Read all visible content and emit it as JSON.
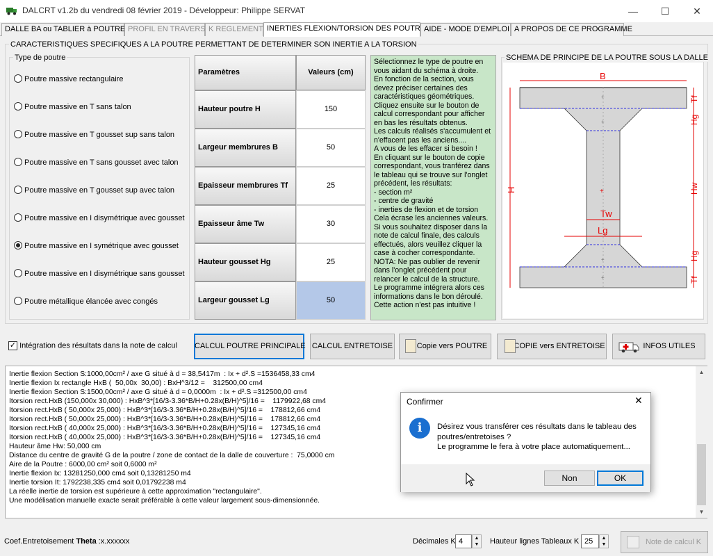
{
  "window": {
    "title": "DALCRT v1.2b du vendredi 08 février 2019 - Développeur: Philippe SERVAT",
    "minimize": "—",
    "maximize": "☐",
    "close": "✕"
  },
  "tabs": [
    {
      "label": "DALLE BA ou TABLIER à POUTRES"
    },
    {
      "label": "PROFIL EN TRAVERS"
    },
    {
      "label": "K REGLEMENT"
    },
    {
      "label": "INERTIES FLEXION/TORSION DES POUTRES"
    },
    {
      "label": "AIDE - MODE D'EMPLOI"
    },
    {
      "label": "A PROPOS DE CE PROGRAMME"
    }
  ],
  "main_group": {
    "title": "CARACTERISTIQUES SPECIFIQUES A LA POUTRE PERMETTANT DE DETERMINER SON INERTIE A LA TORSION"
  },
  "poutre_type": {
    "title": "Type de poutre",
    "options": [
      {
        "label": "Poutre massive rectangulaire",
        "selected": false
      },
      {
        "label": "Poutre massive en T sans talon",
        "selected": false
      },
      {
        "label": "Poutre massive en T gousset sup sans talon",
        "selected": false
      },
      {
        "label": "Poutre massive en T sans gousset avec talon",
        "selected": false
      },
      {
        "label": "Poutre massive en T gousset sup avec talon",
        "selected": false
      },
      {
        "label": "Poutre massive en I disymétrique avec gousset",
        "selected": false
      },
      {
        "label": "Poutre massive en I symétrique avec gousset",
        "selected": true
      },
      {
        "label": "Poutre massive en I disymétrique sans gousset",
        "selected": false
      },
      {
        "label": "Poutre métallique élancée avec congés",
        "selected": false
      }
    ]
  },
  "params_table": {
    "header_param": "Paramètres",
    "header_value": "Valeurs (cm)",
    "rows": [
      {
        "param": "Hauteur poutre H",
        "value": "150"
      },
      {
        "param": "Largeur membrures B",
        "value": "50"
      },
      {
        "param": "Epaisseur membrures Tf",
        "value": "25"
      },
      {
        "param": "Epaisseur âme Tw",
        "value": "30"
      },
      {
        "param": "Hauteur gousset Hg",
        "value": "25"
      },
      {
        "param": "Largeur gousset Lg",
        "value": "50"
      }
    ]
  },
  "info_text": "Sélectionnez le type de poutre en vous aidant du schéma à droite.\nEn fonction de la section, vous devez préciser certaines des caractéristiques géométriques.\nCliquez ensuite sur le bouton de calcul correspondant pour afficher en bas les résultats obtenus.\nLes calculs réalisés s'accumulent et n'effacent pas les anciens....\nA vous de les effacer si besoin !\nEn cliquant sur le bouton de copie correspondant, vous tranférez dans le tableau qui se trouve sur l'onglet précédent, les résultats:\n- section m²\n- centre de gravité\n- inerties de flexion et de torsion\nCela écrase les anciennes valeurs.\nSi vous souhaitez disposer dans la note de calcul finale, des calculs effectués, alors veuillez cliquer la case à cocher correspondante.\nNOTA: Ne pas oublier de revenir dans l'onglet précédent pour relancer le calcul de la structure.\nLe programme intégrera alors ces informations dans le bon déroulé.\nCette action n'est pas intuitive !",
  "schema": {
    "title": "SCHEMA DE PRINCIPE DE LA POUTRE SOUS LA DALLE",
    "labels": {
      "B": "B",
      "Tf": "Tf",
      "Hg": "Hg",
      "H": "H",
      "Hw": "Hw",
      "Tw": "Tw",
      "Lg": "Lg"
    }
  },
  "checkbox": {
    "label": "Intégration des résultats dans la note de calcul",
    "checked": true
  },
  "buttons": {
    "calcul_poutre": "CALCUL POUTRE PRINCIPALE",
    "calcul_entretoise": "CALCUL ENTRETOISE",
    "copie_poutre": "Copie vers POUTRE",
    "copie_entretoise": "COPIE vers ENTRETOISE",
    "infos_utiles": "INFOS UTILES"
  },
  "results": [
    "Inertie flexion Section S:1000,00cm² / axe G situé à d = 38,5417m  : Ix + d².S =1536458,33 cm4",
    "Inertie flexion Ix rectangle HxB (  50,00x  30,00) : BxH^3/12 =    312500,00 cm4",
    "Inertie flexion Section S:1500,00cm² / axe G situé à d = 0,0000m  : Ix + d².S =312500,00 cm4",
    "Itorsion rect.HxB (150,000x 30,000) : HxB^3*[16/3-3.36*B/H+0.28x(B/H)^5]/16 =    1179922,68 cm4",
    "Itorsion rect.HxB ( 50,000x 25,000) : HxB^3*[16/3-3.36*B/H+0.28x(B/H)^5]/16 =    178812,66 cm4",
    "Itorsion rect.HxB ( 50,000x 25,000) : HxB^3*[16/3-3.36*B/H+0.28x(B/H)^5]/16 =    178812,66 cm4",
    "Itorsion rect.HxB ( 40,000x 25,000) : HxB^3*[16/3-3.36*B/H+0.28x(B/H)^5]/16 =    127345,16 cm4",
    "Itorsion rect.HxB ( 40,000x 25,000) : HxB^3*[16/3-3.36*B/H+0.28x(B/H)^5]/16 =    127345,16 cm4",
    "Hauteur âme Hw: 50,000 cm",
    "Distance du centre de gravité G de la poutre / zone de contact de la dalle de couverture :  75,0000 cm",
    "Aire de la Poutre : 6000,00 cm² soit 0,6000 m²",
    "Inertie flexion Ix: 13281250,000 cm4 soit 0,13281250 m4",
    "Inertie torsion It: 1792238,335 cm4 soit 0,01792238 m4",
    "La réelle inertie de torsion est supérieure à cette approximation \"rectangulaire\".",
    "Une modélisation manuelle exacte serait préférable à cette valeur largement sous-dimensionnée."
  ],
  "dialog": {
    "title": "Confirmer",
    "close": "✕",
    "icon": "i",
    "message_1": "Désirez vous transférer ces résultats dans le tableau des poutres/entretoises ?",
    "message_2": "Le programme le fera à votre place automatiquement...",
    "btn_non": "Non",
    "btn_ok": "OK"
  },
  "bottom": {
    "coef_label": "Coef.Entretoisement ",
    "coef_theta": "Theta",
    "coef_value": " :x.xxxxxx",
    "decimales_label": "Décimales K",
    "decimales_value": "4",
    "hauteur_label": "Hauteur lignes Tableaux K",
    "hauteur_value": "25",
    "note_calcul": "Note de calcul K"
  },
  "colors": {
    "info_bg": "#c8e6c8",
    "selected_cell": "#b4c8e8",
    "schema_red": "#e60000",
    "accent_blue": "#0078d7"
  }
}
